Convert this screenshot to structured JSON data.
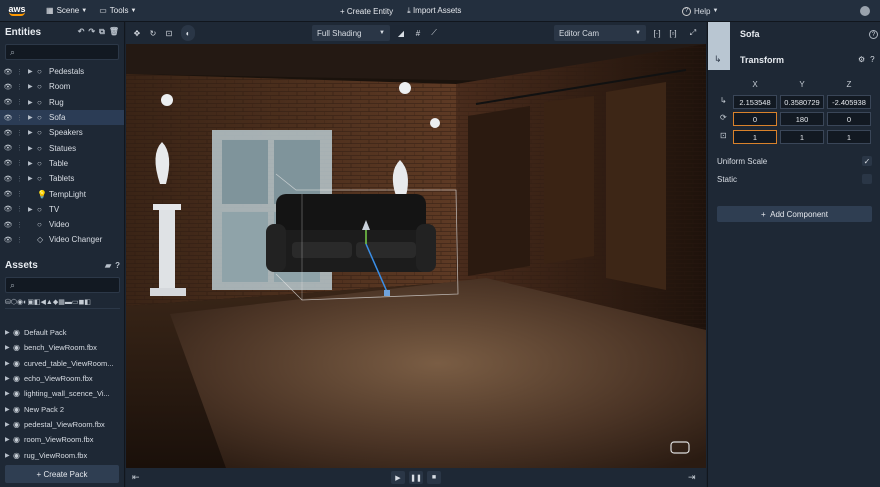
{
  "topbar": {
    "logo": "aws",
    "menus": [
      {
        "label": "Scene"
      },
      {
        "label": "Tools"
      }
    ],
    "create_entity": "Create Entity",
    "import_assets": "Import Assets",
    "help": "Help"
  },
  "entities": {
    "title": "Entities",
    "items": [
      {
        "label": "Pedestals",
        "has_children": true
      },
      {
        "label": "Room",
        "has_children": true
      },
      {
        "label": "Rug",
        "has_children": true
      },
      {
        "label": "Sofa",
        "has_children": true,
        "selected": true
      },
      {
        "label": "Speakers",
        "has_children": true
      },
      {
        "label": "Statues",
        "has_children": true
      },
      {
        "label": "Table",
        "has_children": true
      },
      {
        "label": "Tablets",
        "has_children": true
      },
      {
        "label": "TempLight",
        "has_children": false
      },
      {
        "label": "TV",
        "has_children": true
      },
      {
        "label": "Video",
        "has_children": false
      },
      {
        "label": "Video Changer",
        "has_children": false
      }
    ]
  },
  "assets": {
    "title": "Assets",
    "items": [
      {
        "label": "Default Pack"
      },
      {
        "label": "bench_ViewRoom.fbx"
      },
      {
        "label": "curved_table_ViewRoom..."
      },
      {
        "label": "echo_ViewRoom.fbx"
      },
      {
        "label": "lighting_wall_scence_Vi..."
      },
      {
        "label": "New Pack 2"
      },
      {
        "label": "pedestal_ViewRoom.fbx"
      },
      {
        "label": "room_ViewRoom.fbx"
      },
      {
        "label": "rug_ViewRoom.fbx"
      }
    ],
    "create_pack": "Create Pack"
  },
  "viewport": {
    "shading": "Full Shading",
    "camera": "Editor Cam"
  },
  "inspector": {
    "entity_name": "Sofa",
    "component": "Transform",
    "axes": [
      "X",
      "Y",
      "Z"
    ],
    "position": [
      "2.153548",
      "0.3580729",
      "-2.405938"
    ],
    "rotation": [
      "0",
      "180",
      "0"
    ],
    "scale": [
      "1",
      "1",
      "1"
    ],
    "uniform_scale_label": "Uniform Scale",
    "uniform_scale": true,
    "static_label": "Static",
    "static": false,
    "add_component": "Add Component"
  },
  "colors": {
    "accent": "#ff9900",
    "selection": "#2b3c55",
    "field_highlight": "#d9822b"
  }
}
